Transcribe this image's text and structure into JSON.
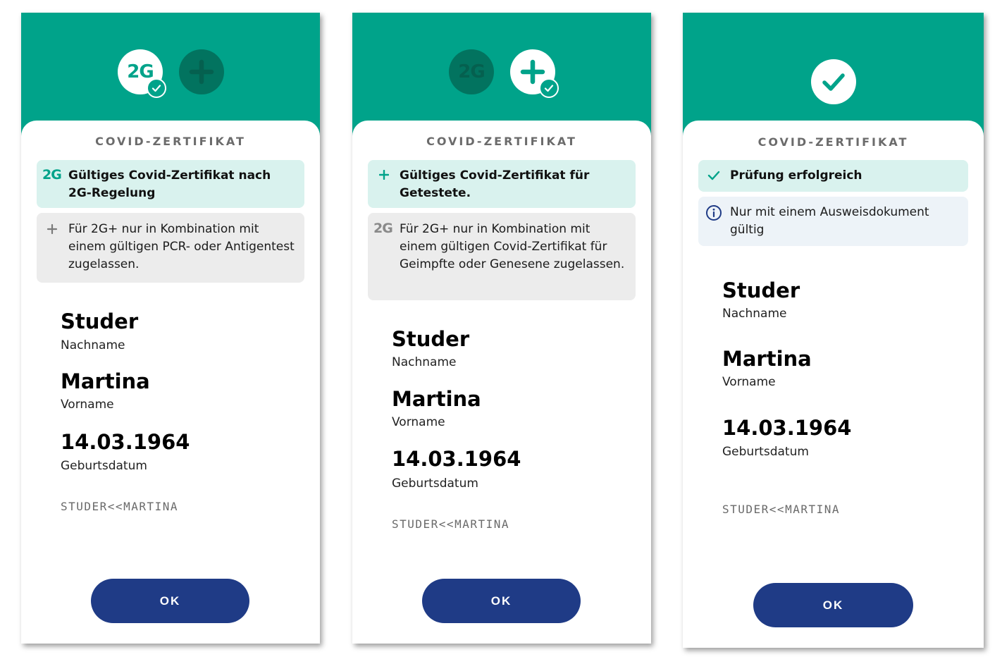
{
  "colors": {
    "header_green": "#00a38a",
    "dark_circle": "#02735f",
    "success_box": "#d9f2ee",
    "info_box_grey": "#ececec",
    "info_box_blue": "#edf3f8",
    "button_navy": "#1f3b86"
  },
  "screens": [
    {
      "header": {
        "icons": [
          {
            "icon": "2g-icon",
            "text": "2G",
            "state": "active",
            "badge": "check-badge-icon"
          },
          {
            "icon": "plus-icon",
            "state": "inactive"
          }
        ]
      },
      "title": "COVID-ZERTIFIKAT",
      "status_primary": {
        "icon_text": "2G",
        "text": "Gültiges Covid-Zertifikat nach 2G-Regelung"
      },
      "status_secondary": {
        "icon": "plus-icon",
        "text": "Für 2G+ nur in Kombination mit einem gültigen PCR- oder Antigentest zugelassen."
      },
      "last_name": "Studer",
      "last_name_label": "Nachname",
      "first_name": "Martina",
      "first_name_label": "Vorname",
      "birthdate": "14.03.1964",
      "birthdate_label": "Geburtsdatum",
      "mrz": "STUDER<<MARTINA",
      "button_label": "OK"
    },
    {
      "header": {
        "icons": [
          {
            "icon": "2g-icon",
            "text": "2G",
            "state": "inactive"
          },
          {
            "icon": "plus-icon",
            "state": "active",
            "badge": "check-badge-icon"
          }
        ]
      },
      "title": "COVID-ZERTIFIKAT",
      "status_primary": {
        "icon": "plus-icon",
        "text": "Gültiges Covid-Zertifikat für Getestete."
      },
      "status_secondary": {
        "icon_text": "2G",
        "text": "Für 2G+ nur in Kombination mit einem gültigen Covid-Zertifikat für Geimpfte oder Genesene zugelassen."
      },
      "last_name": "Studer",
      "last_name_label": "Nachname",
      "first_name": "Martina",
      "first_name_label": "Vorname",
      "birthdate": "14.03.1964",
      "birthdate_label": "Geburtsdatum",
      "mrz": "STUDER<<MARTINA",
      "button_label": "OK"
    },
    {
      "header": {
        "icons": [
          {
            "icon": "checkmark-icon",
            "state": "active"
          }
        ]
      },
      "title": "COVID-ZERTIFIKAT",
      "status_primary": {
        "icon": "checkmark-icon",
        "text": "Prüfung erfolgreich"
      },
      "status_secondary": {
        "icon": "info-icon",
        "text": "Nur mit einem Ausweisdokument gültig"
      },
      "last_name": "Studer",
      "last_name_label": "Nachname",
      "first_name": "Martina",
      "first_name_label": "Vorname",
      "birthdate": "14.03.1964",
      "birthdate_label": "Geburtsdatum",
      "mrz": "STUDER<<MARTINA",
      "button_label": "OK"
    }
  ]
}
